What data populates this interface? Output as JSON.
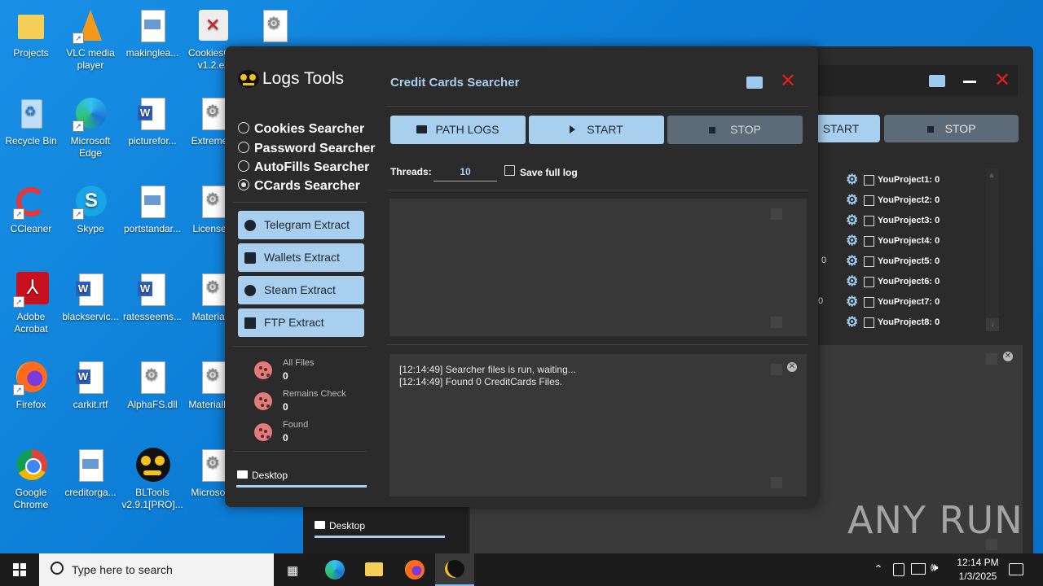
{
  "desktop": {
    "icons": [
      {
        "label": "Projects",
        "icon": "folder-icon"
      },
      {
        "label": "VLC media player",
        "icon": "vlc-icon"
      },
      {
        "label": "makinglea...",
        "icon": "image-file-icon"
      },
      {
        "label": "CookiesC... v1.2.ex",
        "icon": "app-icon"
      },
      {
        "label": "",
        "icon": "gear-file-icon"
      },
      {
        "label": "Recycle Bin",
        "icon": "recycle-bin-icon"
      },
      {
        "label": "Microsoft Edge",
        "icon": "edge-icon"
      },
      {
        "label": "picturefor...",
        "icon": "word-file-icon"
      },
      {
        "label": "Extreme...",
        "icon": "gear-file-icon"
      },
      {
        "label": "CCleaner",
        "icon": "ccleaner-icon"
      },
      {
        "label": "Skype",
        "icon": "skype-icon"
      },
      {
        "label": "portstandar...",
        "icon": "image-file-icon"
      },
      {
        "label": "License...",
        "icon": "gear-file-icon"
      },
      {
        "label": "Adobe Acrobat",
        "icon": "acrobat-icon"
      },
      {
        "label": "blackservic...",
        "icon": "word-file-icon"
      },
      {
        "label": "ratesseems...",
        "icon": "word-file-icon"
      },
      {
        "label": "Material...",
        "icon": "gear-file-icon"
      },
      {
        "label": "Firefox",
        "icon": "firefox-icon"
      },
      {
        "label": "carkit.rtf",
        "icon": "word-file-icon"
      },
      {
        "label": "AlphaFS.dll",
        "icon": "gear-file-icon"
      },
      {
        "label": "MaterialD...",
        "icon": "gear-file-icon"
      },
      {
        "label": "Google Chrome",
        "icon": "chrome-icon"
      },
      {
        "label": "creditorga...",
        "icon": "image-file-icon"
      },
      {
        "label": "BLTools v2.9.1[PRO]...",
        "icon": "bltools-icon"
      },
      {
        "label": "Microsof...",
        "icon": "gear-file-icon"
      }
    ]
  },
  "bg_window": {
    "start_label": "START",
    "stop_label": "STOP",
    "projects": [
      "YouProject1: 0",
      "YouProject2: 0",
      "YouProject3: 0",
      "YouProject4: 0",
      "YouProject5: 0",
      "YouProject6: 0",
      "YouProject7: 0",
      "YouProject8: 0"
    ],
    "stray_zero_1": "0",
    "stray_zero_2": "0",
    "desktop_tab": "Desktop"
  },
  "app": {
    "title": "Logs Tools",
    "modes": [
      {
        "label": "Cookies Searcher",
        "selected": false
      },
      {
        "label": "Password Searcher",
        "selected": false
      },
      {
        "label": "AutoFills Searcher",
        "selected": false
      },
      {
        "label": "CCards Searcher",
        "selected": true
      }
    ],
    "extract_buttons": [
      "Telegram Extract",
      "Wallets Extract",
      "Steam Extract",
      "FTP Extract"
    ],
    "stats": [
      {
        "label": "All Files",
        "value": "0"
      },
      {
        "label": "Remains Check",
        "value": "0"
      },
      {
        "label": "Found",
        "value": "0"
      }
    ],
    "desktop_tab": "Desktop",
    "panel_title": "Credit Cards Searcher",
    "path_logs_label": "PATH LOGS",
    "start_label": "START",
    "stop_label": "STOP",
    "threads_label": "Threads:",
    "threads_value": "10",
    "save_full_log_label": "Save full log",
    "log_lines": [
      "[12:14:49] Searcher files is run, waiting...",
      "[12:14:49] Found 0 CreditCards Files."
    ],
    "colors": {
      "accent": "#a8d0ee",
      "bg": "#2b2b2b",
      "close": "#e0201b"
    }
  },
  "taskbar": {
    "search_placeholder": "Type here to search",
    "time": "12:14 PM",
    "date": "1/3/2025"
  },
  "watermark": "ANY RUN"
}
